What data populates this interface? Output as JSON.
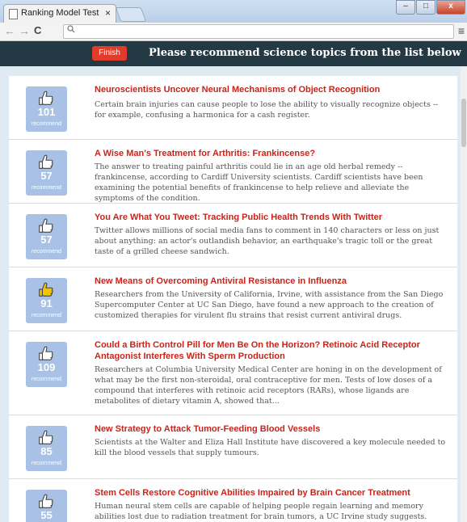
{
  "browser": {
    "tab_title": "Ranking Model Test",
    "tab_close": "×",
    "nav_back": "←",
    "nav_forward": "→",
    "nav_reload": "C",
    "search_glyph": "🔍",
    "menu_glyph": "≡"
  },
  "header": {
    "finish_label": "Finish",
    "prompt": "Please recommend science topics from the list below",
    "background": "#233a44",
    "finish_color": "#e13b2c"
  },
  "items": [
    {
      "count": "101",
      "rec": "recommend",
      "highlighted": false,
      "headline": "Neuroscientists Uncover Neural Mechanisms of Object Recognition",
      "summary": "Certain brain injuries can cause people to lose the ability to visually recognize objects -- for example, confusing a harmonica for a cash register."
    },
    {
      "count": "57",
      "rec": "recommend",
      "highlighted": false,
      "headline": "A Wise Man's Treatment for Arthritis: Frankincense?",
      "summary": "The answer to treating painful arthritis could lie in an age old herbal remedy -- frankincense, according to Cardiff University scientists. Cardiff scientists have been examining the potential benefits of frankincense to help relieve and alleviate the symptoms of the condition."
    },
    {
      "count": "57",
      "rec": "recommend",
      "highlighted": false,
      "headline": "You Are What You Tweet: Tracking Public Health Trends With Twitter",
      "summary": "Twitter allows millions of social media fans to comment in 140 characters or less on just about anything: an actor's outlandish behavior, an earthquake's tragic toll or the great taste of a grilled cheese sandwich."
    },
    {
      "count": "91",
      "rec": "recommend",
      "highlighted": true,
      "headline": "New Means of Overcoming Antiviral Resistance in Influenza",
      "summary": "Researchers from the University of California, Irvine, with assistance from the San Diego Supercomputer Center at UC San Diego, have found a new approach to the creation of customized therapies for virulent flu strains that resist current antiviral drugs."
    },
    {
      "count": "109",
      "rec": "recommend",
      "highlighted": false,
      "headline": "Could a Birth Control Pill for Men Be On the Horizon? Retinoic Acid Receptor Antagonist Interferes With Sperm Production",
      "summary": "Researchers at Columbia University Medical Center are honing in on the development of what may be the first non-steroidal, oral contraceptive for men. Tests of low doses of a compound that interferes with retinoic acid receptors (RARs), whose ligands are metabolites of dietary vitamin A, showed that..."
    },
    {
      "count": "85",
      "rec": "recommend",
      "highlighted": false,
      "headline": "New Strategy to Attack Tumor-Feeding Blood Vessels",
      "summary": "Scientists at the Walter and Eliza Hall Institute have discovered a key molecule needed to kill the blood vessels that supply tumours."
    },
    {
      "count": "55",
      "rec": "recommend",
      "highlighted": false,
      "headline": "Stem Cells Restore Cognitive Abilities Impaired by Brain Cancer Treatment",
      "summary": "Human neural stem cells are capable of helping people regain learning and memory abilities lost due to radiation treatment for brain tumors, a UC Irvine study suggests."
    }
  ]
}
